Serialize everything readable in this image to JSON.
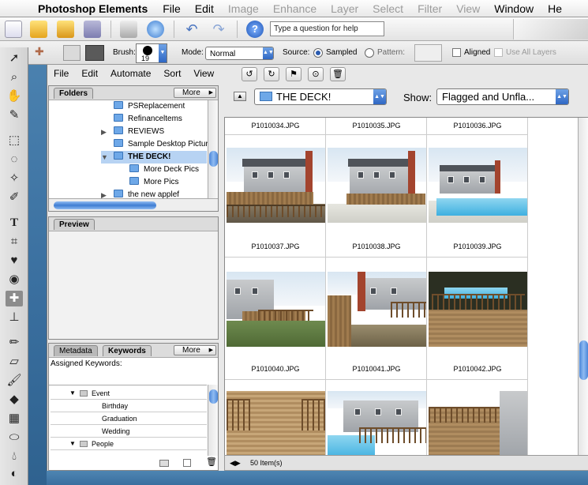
{
  "menubar": {
    "app": "Photoshop Elements",
    "items": [
      {
        "label": "File",
        "enabled": true
      },
      {
        "label": "Edit",
        "enabled": true
      },
      {
        "label": "Image",
        "enabled": false
      },
      {
        "label": "Enhance",
        "enabled": false
      },
      {
        "label": "Layer",
        "enabled": false
      },
      {
        "label": "Select",
        "enabled": false
      },
      {
        "label": "Filter",
        "enabled": false
      },
      {
        "label": "View",
        "enabled": false
      },
      {
        "label": "Window",
        "enabled": true
      },
      {
        "label": "He",
        "enabled": true
      }
    ]
  },
  "shortcuts": {
    "help_text": "Type a question for help",
    "icons": [
      "new-file-icon",
      "open-folder-icon",
      "browse-icon",
      "save-icon",
      "print-icon",
      "web-icon",
      "undo-icon",
      "redo-icon",
      "help-icon"
    ]
  },
  "options": {
    "brush_label": "Brush:",
    "brush_size": "19",
    "mode_label": "Mode:",
    "mode_value": "Normal",
    "source_label": "Source:",
    "sampled_label": "Sampled",
    "pattern_label": "Pattern:",
    "aligned_label": "Aligned",
    "use_all_layers_label": "Use All Layers"
  },
  "file_browser": {
    "menu": [
      "File",
      "Edit",
      "Automate",
      "Sort",
      "View"
    ],
    "folders_panel": {
      "tab": "Folders",
      "more": "More",
      "items": [
        {
          "label": "PSReplacement",
          "indent": 1,
          "expander": false,
          "selected": false
        },
        {
          "label": "Refinanceltems",
          "indent": 1,
          "expander": false,
          "selected": false
        },
        {
          "label": "REVIEWS",
          "indent": 1,
          "expander": true,
          "selected": false
        },
        {
          "label": "Sample Desktop Pictur",
          "indent": 1,
          "expander": false,
          "selected": false
        },
        {
          "label": "THE DECK!",
          "indent": 1,
          "expander": true,
          "selected": true
        },
        {
          "label": "More Deck Pics",
          "indent": 2,
          "expander": false,
          "selected": false
        },
        {
          "label": "More Pics",
          "indent": 2,
          "expander": false,
          "selected": false
        },
        {
          "label": "the new applef",
          "indent": 1,
          "expander": true,
          "selected": false
        }
      ]
    },
    "preview_panel": {
      "tab": "Preview"
    },
    "keywords_panel": {
      "tabs": [
        "Metadata",
        "Keywords"
      ],
      "more": "More",
      "assigned_label": "Assigned Keywords:",
      "rows": [
        {
          "label": "Event",
          "type": "group"
        },
        {
          "label": "Birthday",
          "type": "item"
        },
        {
          "label": "Graduation",
          "type": "item"
        },
        {
          "label": "Wedding",
          "type": "item"
        },
        {
          "label": "People",
          "type": "group"
        }
      ]
    },
    "location": "THE DECK!",
    "show_label": "Show:",
    "show_value": "Flagged and Unfla...",
    "status": "50 Item(s)",
    "top_labels": [
      "P1010034.JPG",
      "P1010035.JPG",
      "P1010036.JPG"
    ],
    "rows": [
      {
        "labels": [
          "P1010037.JPG",
          "P1010038.JPG",
          "P1010039.JPG"
        ]
      },
      {
        "labels": [
          "P1010040.JPG",
          "P1010041.JPG",
          "P1010042.JPG"
        ]
      }
    ]
  },
  "colors": {
    "accent": "#3f7dd3",
    "selection": "#b7d3f3",
    "desktop": "#3a6f9f"
  }
}
